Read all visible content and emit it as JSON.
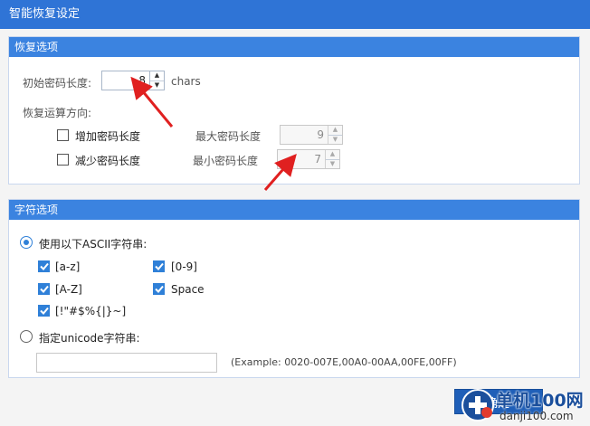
{
  "window": {
    "title": "智能恢复设定"
  },
  "recovery": {
    "heading": "恢复选项",
    "init_length_label": "初始密码长度:",
    "init_length_value": "8",
    "chars_unit": "chars",
    "direction_label": "恢复运算方向:",
    "increase_label": "增加密码长度",
    "decrease_label": "减少密码长度",
    "max_length_label": "最大密码长度",
    "max_length_value": "9",
    "min_length_label": "最小密码长度",
    "min_length_value": "7"
  },
  "charset": {
    "heading": "字符选项",
    "use_ascii_label": "使用以下ASCII字符串:",
    "options": [
      {
        "label": "[a-z]",
        "checked": true
      },
      {
        "label": "[0-9]",
        "checked": true
      },
      {
        "label": "[A-Z]",
        "checked": true
      },
      {
        "label": "Space",
        "checked": true
      },
      {
        "label": "[!\"#$%{|}~]",
        "checked": true
      }
    ],
    "unicode_label": "指定unicode字符串:",
    "unicode_value": "",
    "example_text": "(Example: 0020-007E,00A0-00AA,00FE,00FF)"
  },
  "footer": {
    "ok_label": "确定"
  },
  "watermark": {
    "text": "单机100网",
    "url": "danji100.com"
  },
  "colors": {
    "accent": "#2f80d8",
    "title_bar": "#2f74d6",
    "annotation_arrow": "#e02020"
  }
}
